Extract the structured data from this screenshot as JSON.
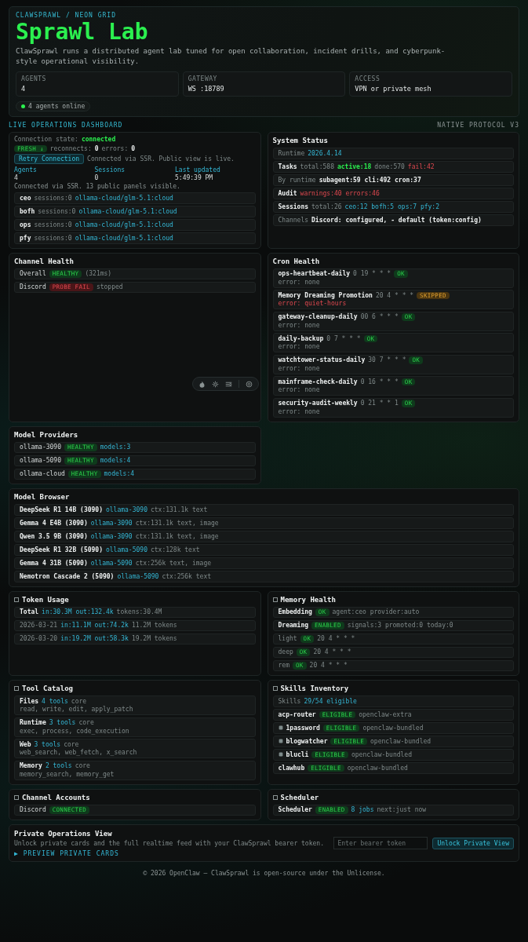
{
  "hero": {
    "brand": "CLAWSPRAWL / NEON GRID",
    "title": "Sprawl Lab",
    "description": "ClawSprawl runs a distributed agent lab tuned for open collaboration, incident drills, and cyberpunk-style operational visibility.",
    "stats": [
      {
        "label": "AGENTS",
        "value": "4"
      },
      {
        "label": "GATEWAY",
        "value": "WS :18789"
      },
      {
        "label": "ACCESS",
        "value": "VPN or private mesh"
      }
    ],
    "status": {
      "text": "4 agents online",
      "online": true
    }
  },
  "section": {
    "title": "LIVE OPERATIONS DASHBOARD",
    "protocol": "NATIVE PROTOCOL V3"
  },
  "panels": [
    {
      "kind": "connection",
      "wide": false,
      "lines": [
        [
          {
            "text": "Connection state:",
            "kind": "muted"
          },
          {
            "text": "connected",
            "kind": "good"
          }
        ],
        [
          {
            "text": "FRESH ↓",
            "kind": "badge-good"
          },
          {
            "text": "reconnects:",
            "kind": "muted"
          },
          {
            "text": "0",
            "kind": "name"
          },
          {
            "text": "errors:",
            "kind": "muted"
          },
          {
            "text": "0",
            "kind": "name"
          }
        ]
      ],
      "button": "Retry Connection",
      "note": "Connected via SSR. Public view is live.",
      "stats": [
        {
          "label": "Agents",
          "value": "4"
        },
        {
          "label": "Sessions",
          "value": "0"
        },
        {
          "label": "Last updated",
          "value": "5:49:39 PM"
        }
      ],
      "summary": "Connected via SSR. 13 public panels visible.",
      "rows": [
        {
          "segments": [
            {
              "text": "ceo",
              "kind": "name"
            },
            {
              "text": "sessions:0",
              "kind": "muted"
            },
            {
              "text": "ollama-cloud/glm-5.1:cloud",
              "kind": "accent"
            }
          ]
        },
        {
          "segments": [
            {
              "text": "bofh",
              "kind": "name"
            },
            {
              "text": "sessions:0",
              "kind": "muted"
            },
            {
              "text": "ollama-cloud/glm-5.1:cloud",
              "kind": "accent"
            }
          ]
        },
        {
          "segments": [
            {
              "text": "ops",
              "kind": "name"
            },
            {
              "text": "sessions:0",
              "kind": "muted"
            },
            {
              "text": "ollama-cloud/glm-5.1:cloud",
              "kind": "accent"
            }
          ]
        },
        {
          "segments": [
            {
              "text": "pfy",
              "kind": "name"
            },
            {
              "text": "sessions:0",
              "kind": "muted"
            },
            {
              "text": "ollama-cloud/glm-5.1:cloud",
              "kind": "accent"
            }
          ]
        }
      ]
    },
    {
      "kind": "list",
      "title": "System Status",
      "wide": false,
      "bullet": false,
      "rows": [
        {
          "segments": [
            {
              "text": "Runtime",
              "kind": "muted"
            },
            {
              "text": "2026.4.14",
              "kind": "accent"
            }
          ]
        },
        {
          "segments": [
            {
              "text": "Tasks",
              "kind": "name"
            },
            {
              "text": "total:588",
              "kind": "muted"
            },
            {
              "text": "active:18",
              "kind": "good"
            },
            {
              "text": "done:570",
              "kind": "muted"
            },
            {
              "text": "fail:42",
              "kind": "bad"
            }
          ]
        },
        {
          "segments": [
            {
              "text": "By runtime",
              "kind": "muted"
            },
            {
              "text": "subagent:59 cli:492 cron:37",
              "kind": "name"
            }
          ]
        },
        {
          "segments": [
            {
              "text": "Audit",
              "kind": "name"
            },
            {
              "text": "warnings:40 errors:46",
              "kind": "bad"
            }
          ]
        },
        {
          "segments": [
            {
              "text": "Sessions",
              "kind": "name"
            },
            {
              "text": "total:26",
              "kind": "muted"
            },
            {
              "text": "ceo:12 bofh:5 ops:7 pfy:2",
              "kind": "accent"
            }
          ]
        },
        {
          "segments": [
            {
              "text": "Channels",
              "kind": "muted"
            },
            {
              "text": "Discord: configured, - default (token:config)",
              "kind": "name"
            }
          ]
        }
      ]
    },
    {
      "kind": "list",
      "title": "Channel Health",
      "wide": false,
      "bullet": false,
      "rows": [
        {
          "segments": [
            {
              "text": "Overall",
              "kind": "plain"
            },
            {
              "text": "HEALTHY",
              "kind": "badge-good"
            },
            {
              "text": "(321ms)",
              "kind": "muted"
            }
          ]
        },
        {
          "segments": [
            {
              "text": "Discord",
              "kind": "plain"
            },
            {
              "text": "PROBE FAIL",
              "kind": "badge-bad"
            },
            {
              "text": "stopped",
              "kind": "muted"
            }
          ]
        }
      ]
    },
    {
      "kind": "list",
      "title": "Cron Health",
      "wide": false,
      "bullet": false,
      "rows": [
        {
          "segments": [
            {
              "text": "ops-heartbeat-daily",
              "kind": "name"
            },
            {
              "text": "0 19 * * *",
              "kind": "muted"
            },
            {
              "text": "OK",
              "kind": "badge-good"
            }
          ],
          "sub": [
            {
              "text": "error: none",
              "kind": "muted"
            }
          ]
        },
        {
          "segments": [
            {
              "text": "Memory Dreaming Promotion",
              "kind": "name"
            },
            {
              "text": "20 4 * * *",
              "kind": "muted"
            },
            {
              "text": "SKIPPED",
              "kind": "badge-warn"
            }
          ],
          "sub": [
            {
              "text": "error: quiet-hours",
              "kind": "bad"
            }
          ]
        },
        {
          "segments": [
            {
              "text": "gateway-cleanup-daily",
              "kind": "name"
            },
            {
              "text": "00 6 * * *",
              "kind": "muted"
            },
            {
              "text": "OK",
              "kind": "badge-good"
            }
          ],
          "sub": [
            {
              "text": "error: none",
              "kind": "muted"
            }
          ]
        },
        {
          "segments": [
            {
              "text": "daily-backup",
              "kind": "name"
            },
            {
              "text": "0 7 * * *",
              "kind": "muted"
            },
            {
              "text": "OK",
              "kind": "badge-good"
            }
          ],
          "sub": [
            {
              "text": "error: none",
              "kind": "muted"
            }
          ]
        },
        {
          "segments": [
            {
              "text": "watchtower-status-daily",
              "kind": "name"
            },
            {
              "text": "30 7 * * *",
              "kind": "muted"
            },
            {
              "text": "OK",
              "kind": "badge-good"
            }
          ],
          "sub": [
            {
              "text": "error: none",
              "kind": "muted"
            }
          ]
        },
        {
          "segments": [
            {
              "text": "mainframe-check-daily",
              "kind": "name"
            },
            {
              "text": "0 16 * * *",
              "kind": "muted"
            },
            {
              "text": "OK",
              "kind": "badge-good"
            }
          ],
          "sub": [
            {
              "text": "error: none",
              "kind": "muted"
            }
          ]
        },
        {
          "segments": [
            {
              "text": "security-audit-weekly",
              "kind": "name"
            },
            {
              "text": "0 21 * * 1",
              "kind": "muted"
            },
            {
              "text": "OK",
              "kind": "badge-good"
            }
          ],
          "sub": [
            {
              "text": "error: none",
              "kind": "muted"
            }
          ]
        }
      ]
    },
    {
      "kind": "list",
      "title": "Model Providers",
      "wide": false,
      "bullet": false,
      "rows": [
        {
          "segments": [
            {
              "text": "ollama-3090",
              "kind": "plain"
            },
            {
              "text": "HEALTHY",
              "kind": "badge-good"
            },
            {
              "text": "models:3",
              "kind": "accent"
            }
          ]
        },
        {
          "segments": [
            {
              "text": "ollama-5090",
              "kind": "plain"
            },
            {
              "text": "HEALTHY",
              "kind": "badge-good"
            },
            {
              "text": "models:4",
              "kind": "accent"
            }
          ]
        },
        {
          "segments": [
            {
              "text": "ollama-cloud",
              "kind": "plain"
            },
            {
              "text": "HEALTHY",
              "kind": "badge-good"
            },
            {
              "text": "models:4",
              "kind": "accent"
            }
          ]
        }
      ]
    },
    {
      "kind": "list",
      "title": "Model Browser",
      "wide": true,
      "bullet": false,
      "rows": [
        {
          "segments": [
            {
              "text": "DeepSeek R1 14B (3090)",
              "kind": "name"
            },
            {
              "text": "ollama-3090",
              "kind": "accent"
            },
            {
              "text": "ctx:131.1k text",
              "kind": "muted"
            }
          ]
        },
        {
          "segments": [
            {
              "text": "Gemma 4 E4B (3090)",
              "kind": "name"
            },
            {
              "text": "ollama-3090",
              "kind": "accent"
            },
            {
              "text": "ctx:131.1k text, image",
              "kind": "muted"
            }
          ]
        },
        {
          "segments": [
            {
              "text": "Qwen 3.5 9B (3090)",
              "kind": "name"
            },
            {
              "text": "ollama-3090",
              "kind": "accent"
            },
            {
              "text": "ctx:131.1k text, image",
              "kind": "muted"
            }
          ]
        },
        {
          "segments": [
            {
              "text": "DeepSeek R1 32B (5090)",
              "kind": "name"
            },
            {
              "text": "ollama-5090",
              "kind": "accent"
            },
            {
              "text": "ctx:128k text",
              "kind": "muted"
            }
          ]
        },
        {
          "segments": [
            {
              "text": "Gemma 4 31B (5090)",
              "kind": "name"
            },
            {
              "text": "ollama-5090",
              "kind": "accent"
            },
            {
              "text": "ctx:256k text, image",
              "kind": "muted"
            }
          ]
        },
        {
          "segments": [
            {
              "text": "Nemotron Cascade 2 (5090)",
              "kind": "name"
            },
            {
              "text": "ollama-5090",
              "kind": "accent"
            },
            {
              "text": "ctx:256k text",
              "kind": "muted"
            }
          ]
        }
      ]
    },
    {
      "kind": "list",
      "title": "Token Usage",
      "wide": false,
      "bullet": true,
      "rows": [
        {
          "segments": [
            {
              "text": "Total",
              "kind": "name"
            },
            {
              "text": "in:30.3M out:132.4k",
              "kind": "accent"
            },
            {
              "text": "tokens:30.4M",
              "kind": "muted"
            }
          ]
        },
        {
          "segments": [
            {
              "text": "2026-03-21",
              "kind": "muted"
            },
            {
              "text": "in:11.1M out:74.2k",
              "kind": "accent"
            },
            {
              "text": "11.2M tokens",
              "kind": "muted"
            }
          ]
        },
        {
          "segments": [
            {
              "text": "2026-03-20",
              "kind": "muted"
            },
            {
              "text": "in:19.2M out:58.3k",
              "kind": "accent"
            },
            {
              "text": "19.2M tokens",
              "kind": "muted"
            }
          ]
        }
      ]
    },
    {
      "kind": "list",
      "title": "Memory Health",
      "wide": false,
      "bullet": true,
      "rows": [
        {
          "segments": [
            {
              "text": "Embedding",
              "kind": "name"
            },
            {
              "text": "OK",
              "kind": "badge-good"
            },
            {
              "text": "agent:ceo provider:auto",
              "kind": "muted"
            }
          ]
        },
        {
          "segments": [
            {
              "text": "Dreaming",
              "kind": "name"
            },
            {
              "text": "ENABLED",
              "kind": "badge-good"
            },
            {
              "text": "signals:3 promoted:0 today:0",
              "kind": "muted"
            }
          ]
        },
        {
          "segments": [
            {
              "text": "light",
              "kind": "muted"
            },
            {
              "text": "OK",
              "kind": "badge-good"
            },
            {
              "text": "20 4 * * *",
              "kind": "muted"
            }
          ]
        },
        {
          "segments": [
            {
              "text": "deep",
              "kind": "muted"
            },
            {
              "text": "OK",
              "kind": "badge-good"
            },
            {
              "text": "20 4 * * *",
              "kind": "muted"
            }
          ]
        },
        {
          "segments": [
            {
              "text": "rem",
              "kind": "muted"
            },
            {
              "text": "OK",
              "kind": "badge-good"
            },
            {
              "text": "20 4 * * *",
              "kind": "muted"
            }
          ]
        }
      ]
    },
    {
      "kind": "list",
      "title": "Tool Catalog",
      "wide": false,
      "bullet": true,
      "rows": [
        {
          "segments": [
            {
              "text": "Files",
              "kind": "name"
            },
            {
              "text": "4 tools",
              "kind": "accent"
            },
            {
              "text": "core",
              "kind": "muted"
            }
          ],
          "sub": [
            {
              "text": "read, write, edit, apply_patch",
              "kind": "muted"
            }
          ]
        },
        {
          "segments": [
            {
              "text": "Runtime",
              "kind": "name"
            },
            {
              "text": "3 tools",
              "kind": "accent"
            },
            {
              "text": "core",
              "kind": "muted"
            }
          ],
          "sub": [
            {
              "text": "exec, process, code_execution",
              "kind": "muted"
            }
          ]
        },
        {
          "segments": [
            {
              "text": "Web",
              "kind": "name"
            },
            {
              "text": "3 tools",
              "kind": "accent"
            },
            {
              "text": "core",
              "kind": "muted"
            }
          ],
          "sub": [
            {
              "text": "web_search, web_fetch, x_search",
              "kind": "muted"
            }
          ]
        },
        {
          "segments": [
            {
              "text": "Memory",
              "kind": "name"
            },
            {
              "text": "2 tools",
              "kind": "accent"
            },
            {
              "text": "core",
              "kind": "muted"
            }
          ],
          "sub": [
            {
              "text": "memory_search, memory_get",
              "kind": "muted"
            }
          ]
        }
      ]
    },
    {
      "kind": "list",
      "title": "Skills Inventory",
      "wide": false,
      "bullet": true,
      "rows": [
        {
          "icon": false,
          "segments": [
            {
              "text": "Skills",
              "kind": "muted"
            },
            {
              "text": "29/54 eligible",
              "kind": "accent"
            }
          ]
        },
        {
          "icon": false,
          "segments": [
            {
              "text": "acp-router",
              "kind": "name"
            },
            {
              "text": "ELIGIBLE",
              "kind": "badge-good"
            },
            {
              "text": "openclaw-extra",
              "kind": "muted"
            }
          ]
        },
        {
          "icon": true,
          "segments": [
            {
              "text": "1password",
              "kind": "name"
            },
            {
              "text": "ELIGIBLE",
              "kind": "badge-good"
            },
            {
              "text": "openclaw-bundled",
              "kind": "muted"
            }
          ]
        },
        {
          "icon": true,
          "segments": [
            {
              "text": "blogwatcher",
              "kind": "name"
            },
            {
              "text": "ELIGIBLE",
              "kind": "badge-good"
            },
            {
              "text": "openclaw-bundled",
              "kind": "muted"
            }
          ]
        },
        {
          "icon": true,
          "segments": [
            {
              "text": "blucli",
              "kind": "name"
            },
            {
              "text": "ELIGIBLE",
              "kind": "badge-good"
            },
            {
              "text": "openclaw-bundled",
              "kind": "muted"
            }
          ]
        },
        {
          "icon": false,
          "segments": [
            {
              "text": "clawhub",
              "kind": "name"
            },
            {
              "text": "ELIGIBLE",
              "kind": "badge-good"
            },
            {
              "text": "openclaw-bundled",
              "kind": "muted"
            }
          ]
        }
      ]
    },
    {
      "kind": "list",
      "title": "Channel Accounts",
      "wide": false,
      "bullet": true,
      "rows": [
        {
          "segments": [
            {
              "text": "Discord",
              "kind": "plain"
            },
            {
              "text": "CONNECTED",
              "kind": "badge-good"
            }
          ]
        }
      ]
    },
    {
      "kind": "list",
      "title": "Scheduler",
      "wide": false,
      "bullet": true,
      "rows": [
        {
          "segments": [
            {
              "text": "Scheduler",
              "kind": "name"
            },
            {
              "text": "ENABLED",
              "kind": "badge-good"
            },
            {
              "text": "8 jobs",
              "kind": "accent"
            },
            {
              "text": "next:just now",
              "kind": "muted"
            }
          ]
        }
      ]
    },
    {
      "kind": "private",
      "title": "Private Operations View",
      "wide": true,
      "text": "Unlock private cards and the full realtime feed with your ClawSprawl bearer token.",
      "link": "▶ PREVIEW PRIVATE CARDS",
      "placeholder": "Enter bearer token",
      "button": "Unlock Private View"
    }
  ],
  "footer": "© 2026 OpenClaw — ClawSprawl is open-source under the Unlicense."
}
